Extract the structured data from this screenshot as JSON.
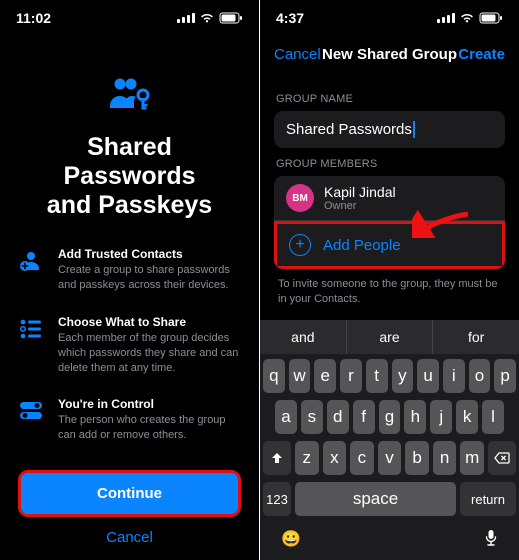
{
  "left": {
    "time": "11:02",
    "title_line1": "Shared Passwords",
    "title_line2": "and Passkeys",
    "features": [
      {
        "title": "Add Trusted Contacts",
        "desc": "Create a group to share passwords and passkeys across their devices."
      },
      {
        "title": "Choose What to Share",
        "desc": "Each member of the group decides which passwords they share and can delete them at any time."
      },
      {
        "title": "You're in Control",
        "desc": "The person who creates the group can add or remove others."
      }
    ],
    "continue": "Continue",
    "cancel": "Cancel"
  },
  "right": {
    "time": "4:37",
    "nav": {
      "cancel": "Cancel",
      "title": "New Shared Group",
      "create": "Create"
    },
    "group_name_label": "GROUP NAME",
    "group_name_value": "Shared Passwords",
    "members_label": "GROUP MEMBERS",
    "member": {
      "initials": "BM",
      "name": "Kapil Jindal",
      "role": "Owner"
    },
    "add_people": "Add People",
    "footnote": "To invite someone to the group, they must be in your Contacts.",
    "suggestions": [
      "and",
      "are",
      "for"
    ],
    "keys_r1": [
      "q",
      "w",
      "e",
      "r",
      "t",
      "y",
      "u",
      "i",
      "o",
      "p"
    ],
    "keys_r2": [
      "a",
      "s",
      "d",
      "f",
      "g",
      "h",
      "j",
      "k",
      "l"
    ],
    "keys_r3": [
      "z",
      "x",
      "c",
      "v",
      "b",
      "n",
      "m"
    ],
    "num_key": "123",
    "space_key": "space",
    "return_key": "return"
  }
}
